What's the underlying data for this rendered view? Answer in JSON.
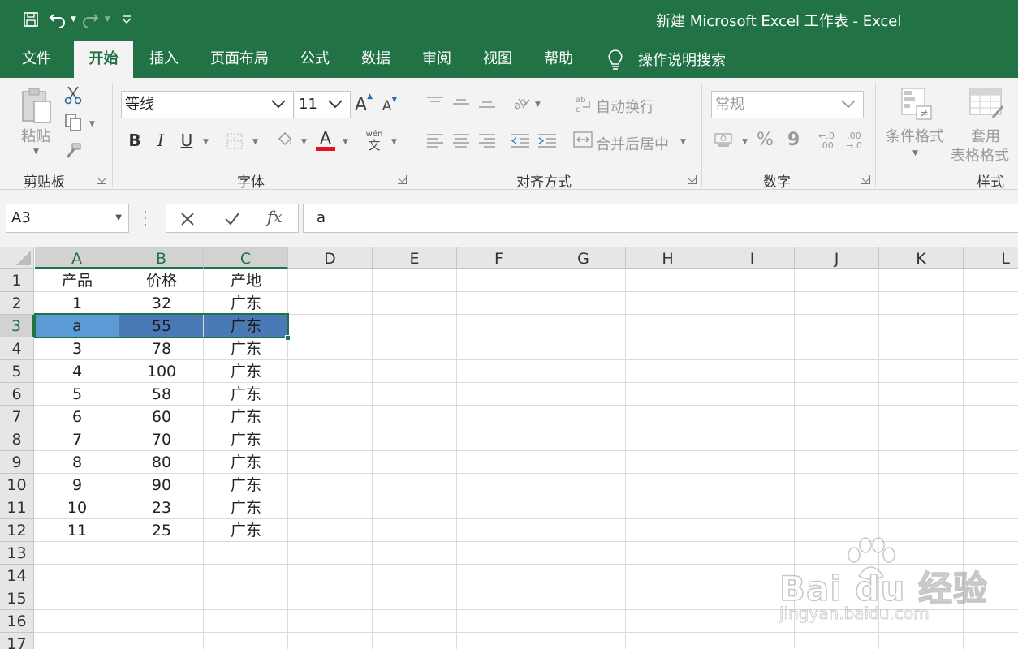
{
  "window": {
    "title": "新建 Microsoft Excel 工作表  -  Excel"
  },
  "tabs": [
    {
      "label": "文件"
    },
    {
      "label": "开始"
    },
    {
      "label": "插入"
    },
    {
      "label": "页面布局"
    },
    {
      "label": "公式"
    },
    {
      "label": "数据"
    },
    {
      "label": "审阅"
    },
    {
      "label": "视图"
    },
    {
      "label": "帮助"
    }
  ],
  "active_tab": "开始",
  "tell_me": {
    "label": "操作说明搜索",
    "icon": "lightbulb-icon"
  },
  "ribbon": {
    "clipboard": {
      "label": "剪贴板",
      "paste_label": "粘贴"
    },
    "font": {
      "label": "字体",
      "font_name": "等线",
      "font_size": "11",
      "phonetic_top": "wén",
      "phonetic_bottom": "文",
      "color_accent": "#e81123"
    },
    "alignment": {
      "label": "对齐方式",
      "wrap_text": "自动换行",
      "merge_center": "合并后居中"
    },
    "number": {
      "label": "数字",
      "format": "常规",
      "percent": "%",
      "comma": "9"
    },
    "styles": {
      "label": "样式",
      "conditional_formatting": "条件格式",
      "format_as_table_line1": "套用",
      "format_as_table_line2": "表格格式"
    }
  },
  "formula_bar": {
    "name_box": "A3",
    "content": "a",
    "fx": "fx"
  },
  "sheet": {
    "columns": [
      "A",
      "B",
      "C",
      "D",
      "E",
      "F",
      "G",
      "H",
      "I",
      "J",
      "K",
      "L"
    ],
    "rows": [
      "1",
      "2",
      "3",
      "4",
      "5",
      "6",
      "7",
      "8",
      "9",
      "10",
      "11",
      "12",
      "13",
      "14",
      "15",
      "16",
      "17"
    ],
    "cells": [
      [
        "产品",
        "价格",
        "产地"
      ],
      [
        "1",
        "32",
        "广东"
      ],
      [
        "a",
        "55",
        "广东"
      ],
      [
        "3",
        "78",
        "广东"
      ],
      [
        "4",
        "100",
        "广东"
      ],
      [
        "5",
        "58",
        "广东"
      ],
      [
        "6",
        "60",
        "广东"
      ],
      [
        "7",
        "70",
        "广东"
      ],
      [
        "8",
        "80",
        "广东"
      ],
      [
        "9",
        "90",
        "广东"
      ],
      [
        "10",
        "23",
        "广东"
      ],
      [
        "11",
        "25",
        "广东"
      ]
    ],
    "selection": {
      "range": "A3:C3",
      "active_cell": "A3"
    }
  },
  "watermark": {
    "main": "Bai du 经验",
    "sub": "jingyan.baidu.com"
  },
  "colors": {
    "brand": "#217346",
    "selection_fill": "#4a7ab5",
    "active_fill": "#5b9bd5"
  }
}
